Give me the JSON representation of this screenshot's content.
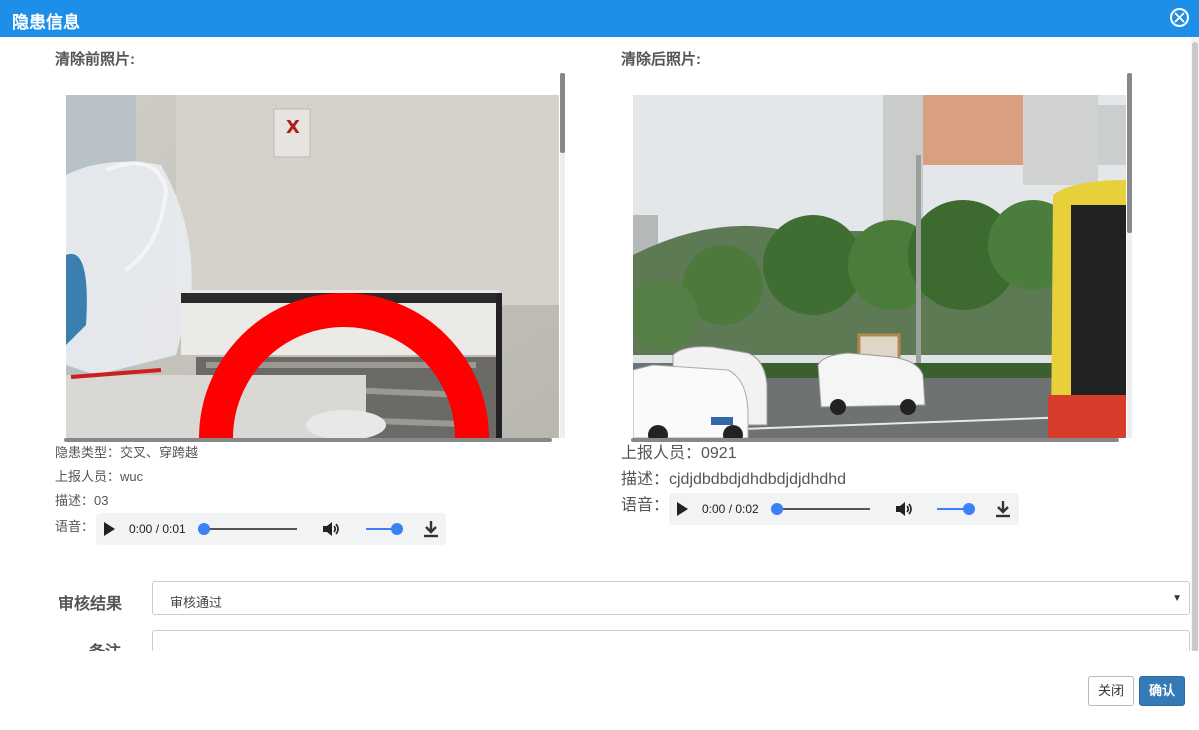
{
  "dialog": {
    "title": "隐患信息"
  },
  "before": {
    "section_title": "清除前照片:",
    "type_line": "隐患类型：交叉、穿跨越",
    "reporter_line": "上报人员：wuc",
    "desc_line": "描述：03",
    "audio_label": "语音：",
    "audio_time": "0:00 / 0:01"
  },
  "after": {
    "section_title": "清除后照片:",
    "reporter_line": "上报人员：0921",
    "desc_line": "描述：cjdjdbdbdjdhdbdjdjdhdhd",
    "audio_label": "语音：",
    "audio_time": "0:00 / 0:02"
  },
  "form": {
    "review_label": "审核结果",
    "review_value": "审核通过",
    "note_label": "备注"
  },
  "footer": {
    "close_label": "关闭",
    "confirm_label": "确认"
  },
  "colors": {
    "titlebar": "#1e8fe8",
    "primary_button": "#337ab7",
    "audio_accent": "#3b82f6"
  }
}
